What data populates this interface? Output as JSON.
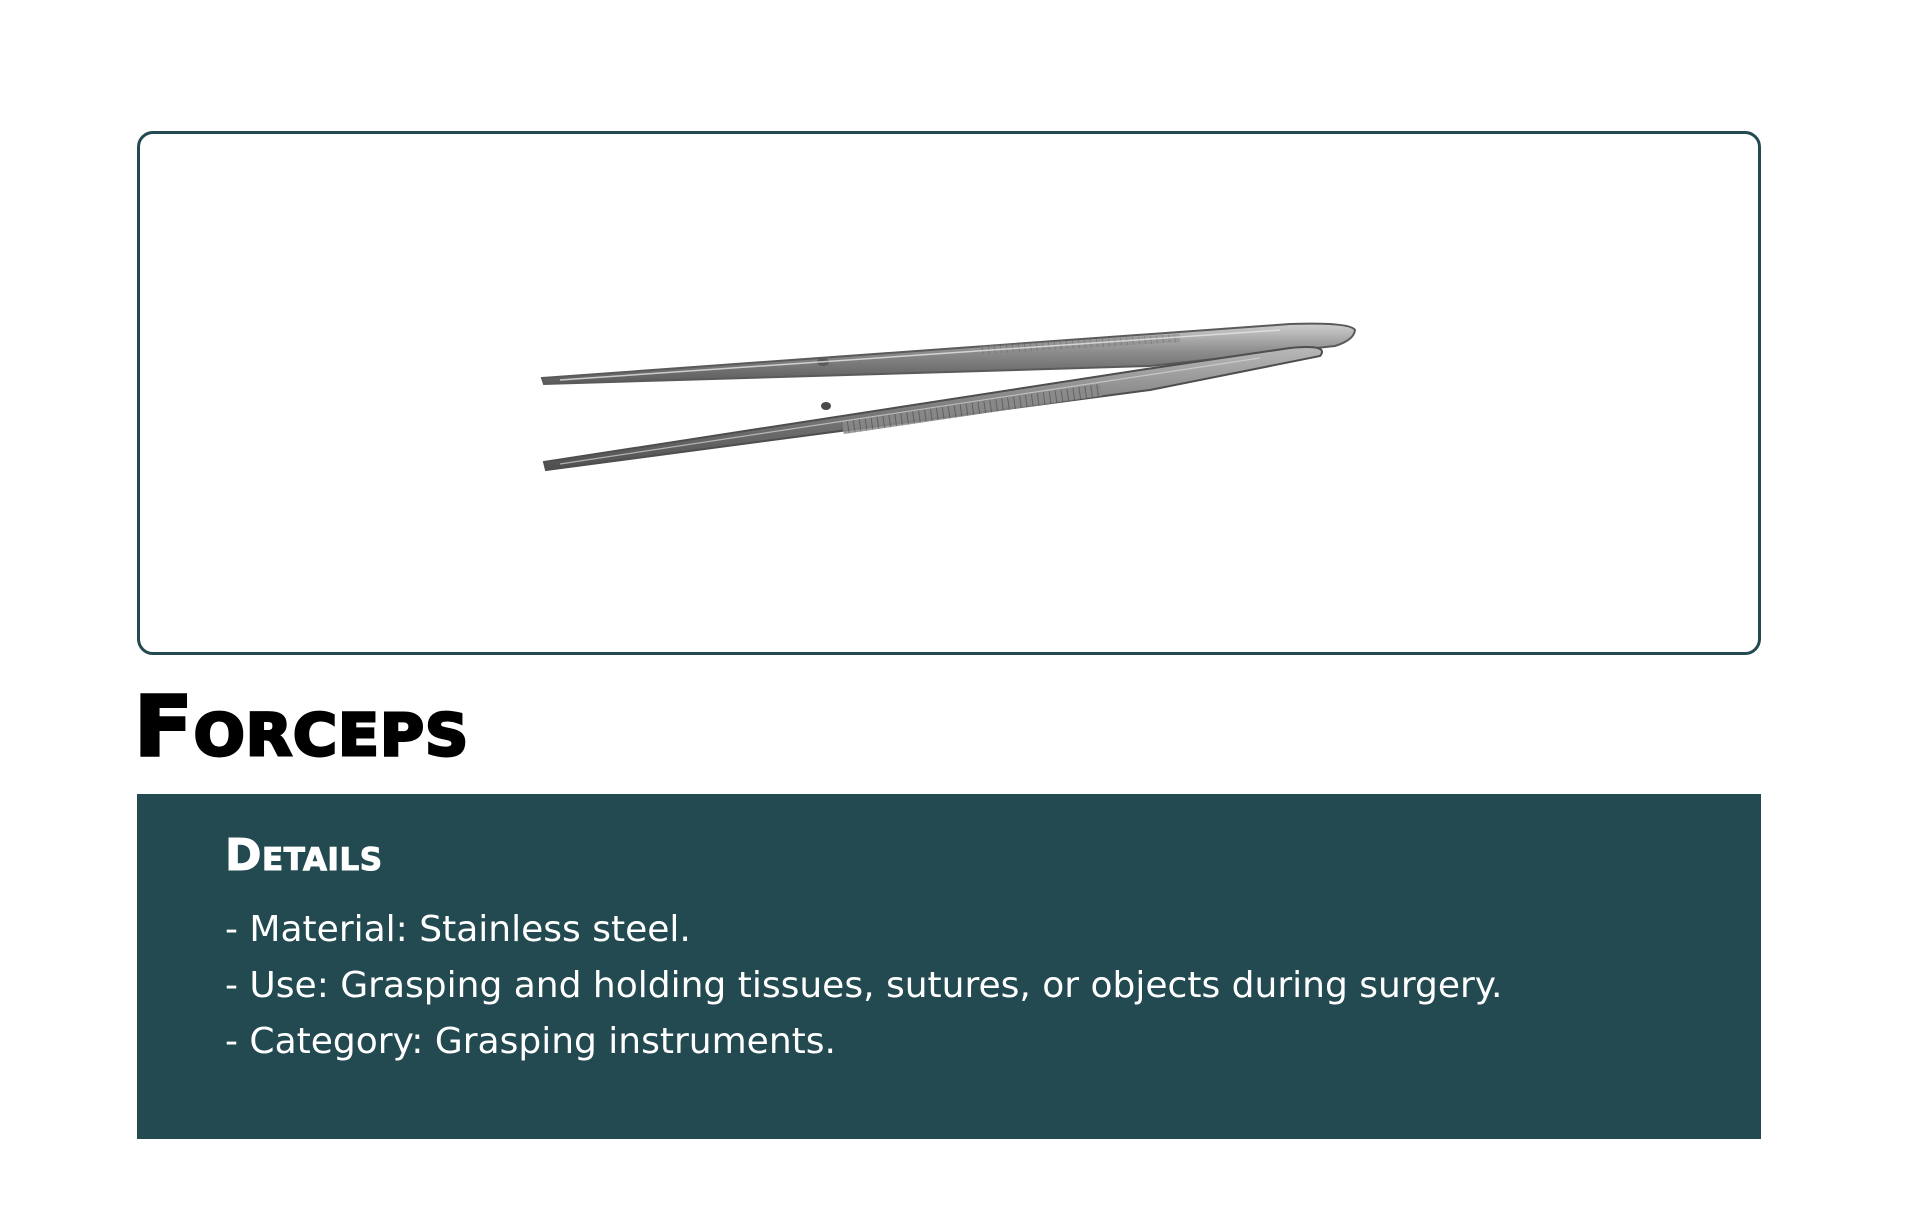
{
  "product": {
    "title": "Forceps",
    "image_alt": "forceps-illustration"
  },
  "details": {
    "heading": "Details",
    "items": [
      "- Material: Stainless steel.",
      "- Use: Grasping and holding tissues, sutures, or objects during surgery.",
      "- Category: Grasping instruments."
    ]
  },
  "colors": {
    "accent": "#234a50",
    "background": "#ffffff",
    "title_text": "#000000",
    "panel_text": "#ffffff"
  }
}
